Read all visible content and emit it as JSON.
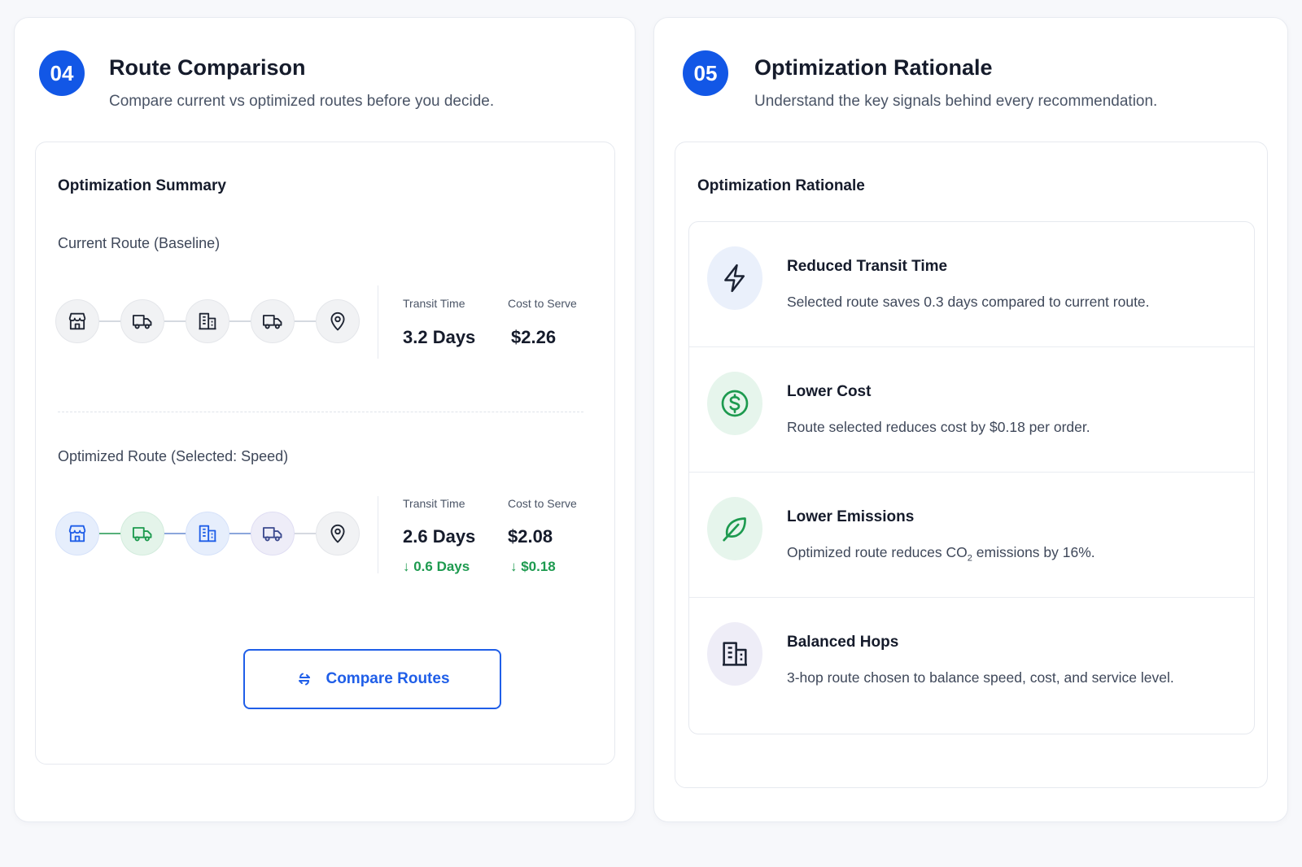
{
  "route_comparison": {
    "badge": "04",
    "title": "Route Comparison",
    "subtitle": "Compare current vs optimized routes before you decide.",
    "card_title": "Optimization Summary",
    "current": {
      "label": "Current Route (Baseline)",
      "nodes": [
        "store-icon",
        "truck-icon",
        "building-icon",
        "truck-icon",
        "location-pin-icon"
      ],
      "transit_label": "Transit Time",
      "transit_value": "3.2 Days",
      "cost_label": "Cost to Serve",
      "cost_value": "$2.26"
    },
    "optimized": {
      "label": "Optimized Route (Selected: Speed)",
      "nodes": [
        "store-icon",
        "truck-icon",
        "building-icon",
        "truck-icon",
        "location-pin-icon"
      ],
      "transit_label": "Transit Time",
      "transit_value": "2.6 Days",
      "transit_delta": "↓ 0.6 Days",
      "cost_label": "Cost to Serve",
      "cost_value": "$2.08",
      "cost_delta": "↓ $0.18"
    },
    "compare_button": "Compare Routes"
  },
  "rationale": {
    "badge": "05",
    "title": "Optimization Rationale",
    "subtitle": "Understand the key signals behind every recommendation.",
    "card_title": "Optimization Rationale",
    "items": [
      {
        "icon": "lightning-icon",
        "title": "Reduced Transit Time",
        "desc": "Selected route saves 0.3 days compared to current route."
      },
      {
        "icon": "dollar-icon",
        "title": "Lower Cost",
        "desc": "Route selected reduces cost by $0.18 per order."
      },
      {
        "icon": "leaf-icon",
        "title": "Lower Emissions",
        "desc_pre": "Optimized route reduces CO",
        "desc_sub": "2",
        "desc_post": " emissions by 16%."
      },
      {
        "icon": "building-icon",
        "title": "Balanced Hops",
        "desc": "3-hop route chosen to balance speed, cost, and service level."
      }
    ]
  },
  "colors": {
    "accent": "#1257e6",
    "positive": "#1d9a4f"
  }
}
